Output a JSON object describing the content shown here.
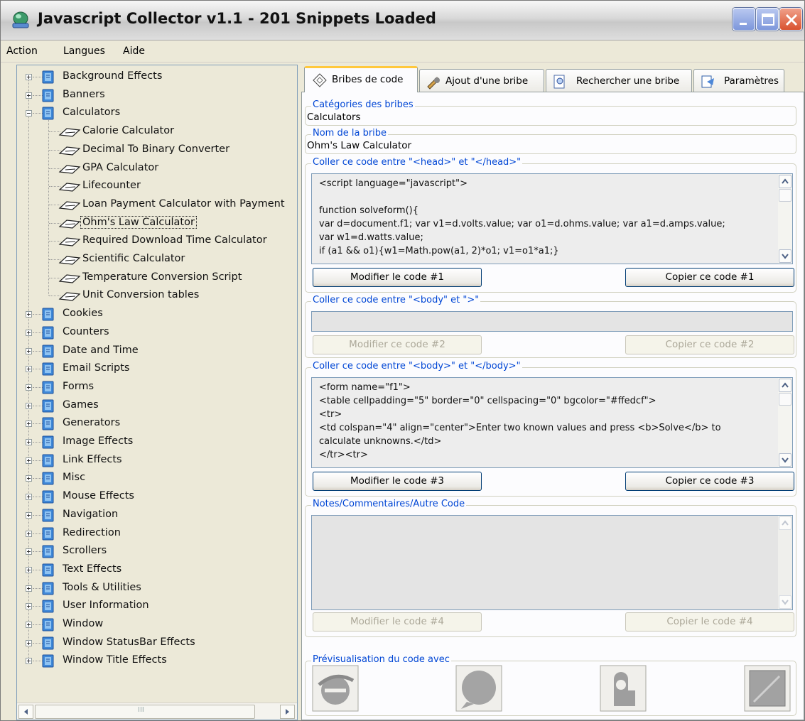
{
  "window": {
    "title": "Javascript Collector v1.1  -  201 Snippets Loaded",
    "controls": [
      "minimize",
      "maximize",
      "close"
    ]
  },
  "menu": [
    "Action",
    "Langues",
    "Aide"
  ],
  "tree": {
    "categories_before": [
      "Background Effects",
      "Banners"
    ],
    "expanded": {
      "label": "Calculators",
      "children": [
        "Calorie Calculator",
        "Decimal To Binary Converter",
        "GPA Calculator",
        "Lifecounter",
        "Loan Payment Calculator with Payment",
        "Ohm's Law Calculator",
        "Required Download Time Calculator",
        "Scientific Calculator",
        "Temperature Conversion Script",
        "Unit Conversion tables"
      ],
      "selected_child": "Ohm's Law Calculator"
    },
    "categories_after": [
      "Cookies",
      "Counters",
      "Date and Time",
      "Email Scripts",
      "Forms",
      "Games",
      "Generators",
      "Image Effects",
      "Link Effects",
      "Misc",
      "Mouse Effects",
      "Navigation",
      "Redirection",
      "Scrollers",
      "Text Effects",
      "Tools & Utilities",
      "User Information",
      "Window",
      "Window StatusBar Effects",
      "Window Title Effects"
    ],
    "hscroll_grip": "III"
  },
  "tabs": [
    {
      "label": "Bribes de code",
      "icon": "diamond-code-icon",
      "active": true
    },
    {
      "label": "Ajout d'une bribe",
      "icon": "pencil-add-icon",
      "active": false
    },
    {
      "label": "Rechercher une bribe",
      "icon": "search-doc-icon",
      "active": false
    },
    {
      "label": "Paramètres",
      "icon": "settings-doc-icon",
      "active": false
    }
  ],
  "snippet": {
    "category_legend": "Catégories des bribes",
    "category_value": "Calculators",
    "name_legend": "Nom de la bribe",
    "name_value": "Ohm's Law Calculator"
  },
  "code1": {
    "legend": "Coller ce code entre \"<head>\" et \"</head>\"",
    "lines": [
      "<script language=\"javascript\">",
      "",
      "function solveform(){",
      "var d=document.f1; var v1=d.volts.value; var o1=d.ohms.value; var a1=d.amps.value;",
      "var w1=d.watts.value;",
      "if (a1 && o1){w1=Math.pow(a1, 2)*o1; v1=o1*a1;}"
    ],
    "edit_label": "Modifier le code #1",
    "copy_label": "Copier ce code #1"
  },
  "code2": {
    "legend": "Coller ce code entre \"<body\" et \">\"",
    "value": "",
    "edit_label": "Modifier ce code #2",
    "copy_label": "Copier ce code  #2"
  },
  "code3": {
    "legend": "Coller ce code entre \"<body>\" et \"</body>\"",
    "lines": [
      "<form name=\"f1\">",
      "<table cellpadding=\"5\" border=\"0\" cellspacing=\"0\" bgcolor=\"#ffedcf\">",
      "<tr>",
      "<td colspan=\"4\" align=\"center\">Enter two known values and press <b>Solve</b> to",
      "calculate unknowns.</td>",
      "</tr><tr>"
    ],
    "edit_label": "Modifier le code #3",
    "copy_label": "Copier ce code #3"
  },
  "code4": {
    "legend": "Notes/Commentaires/Autre Code",
    "value": "",
    "edit_label": "Modifier le code #4",
    "copy_label": "Copier le code #4"
  },
  "preview": {
    "legend": "Prévisualisation du code avec",
    "browsers": [
      "internet-explorer-icon",
      "netscape-icon",
      "opera-icon",
      "generic-browser-icon"
    ]
  },
  "colors": {
    "legend_blue": "#0046d5",
    "tab_highlight": "#ffc83c",
    "window_bg": "#ece9d8"
  }
}
